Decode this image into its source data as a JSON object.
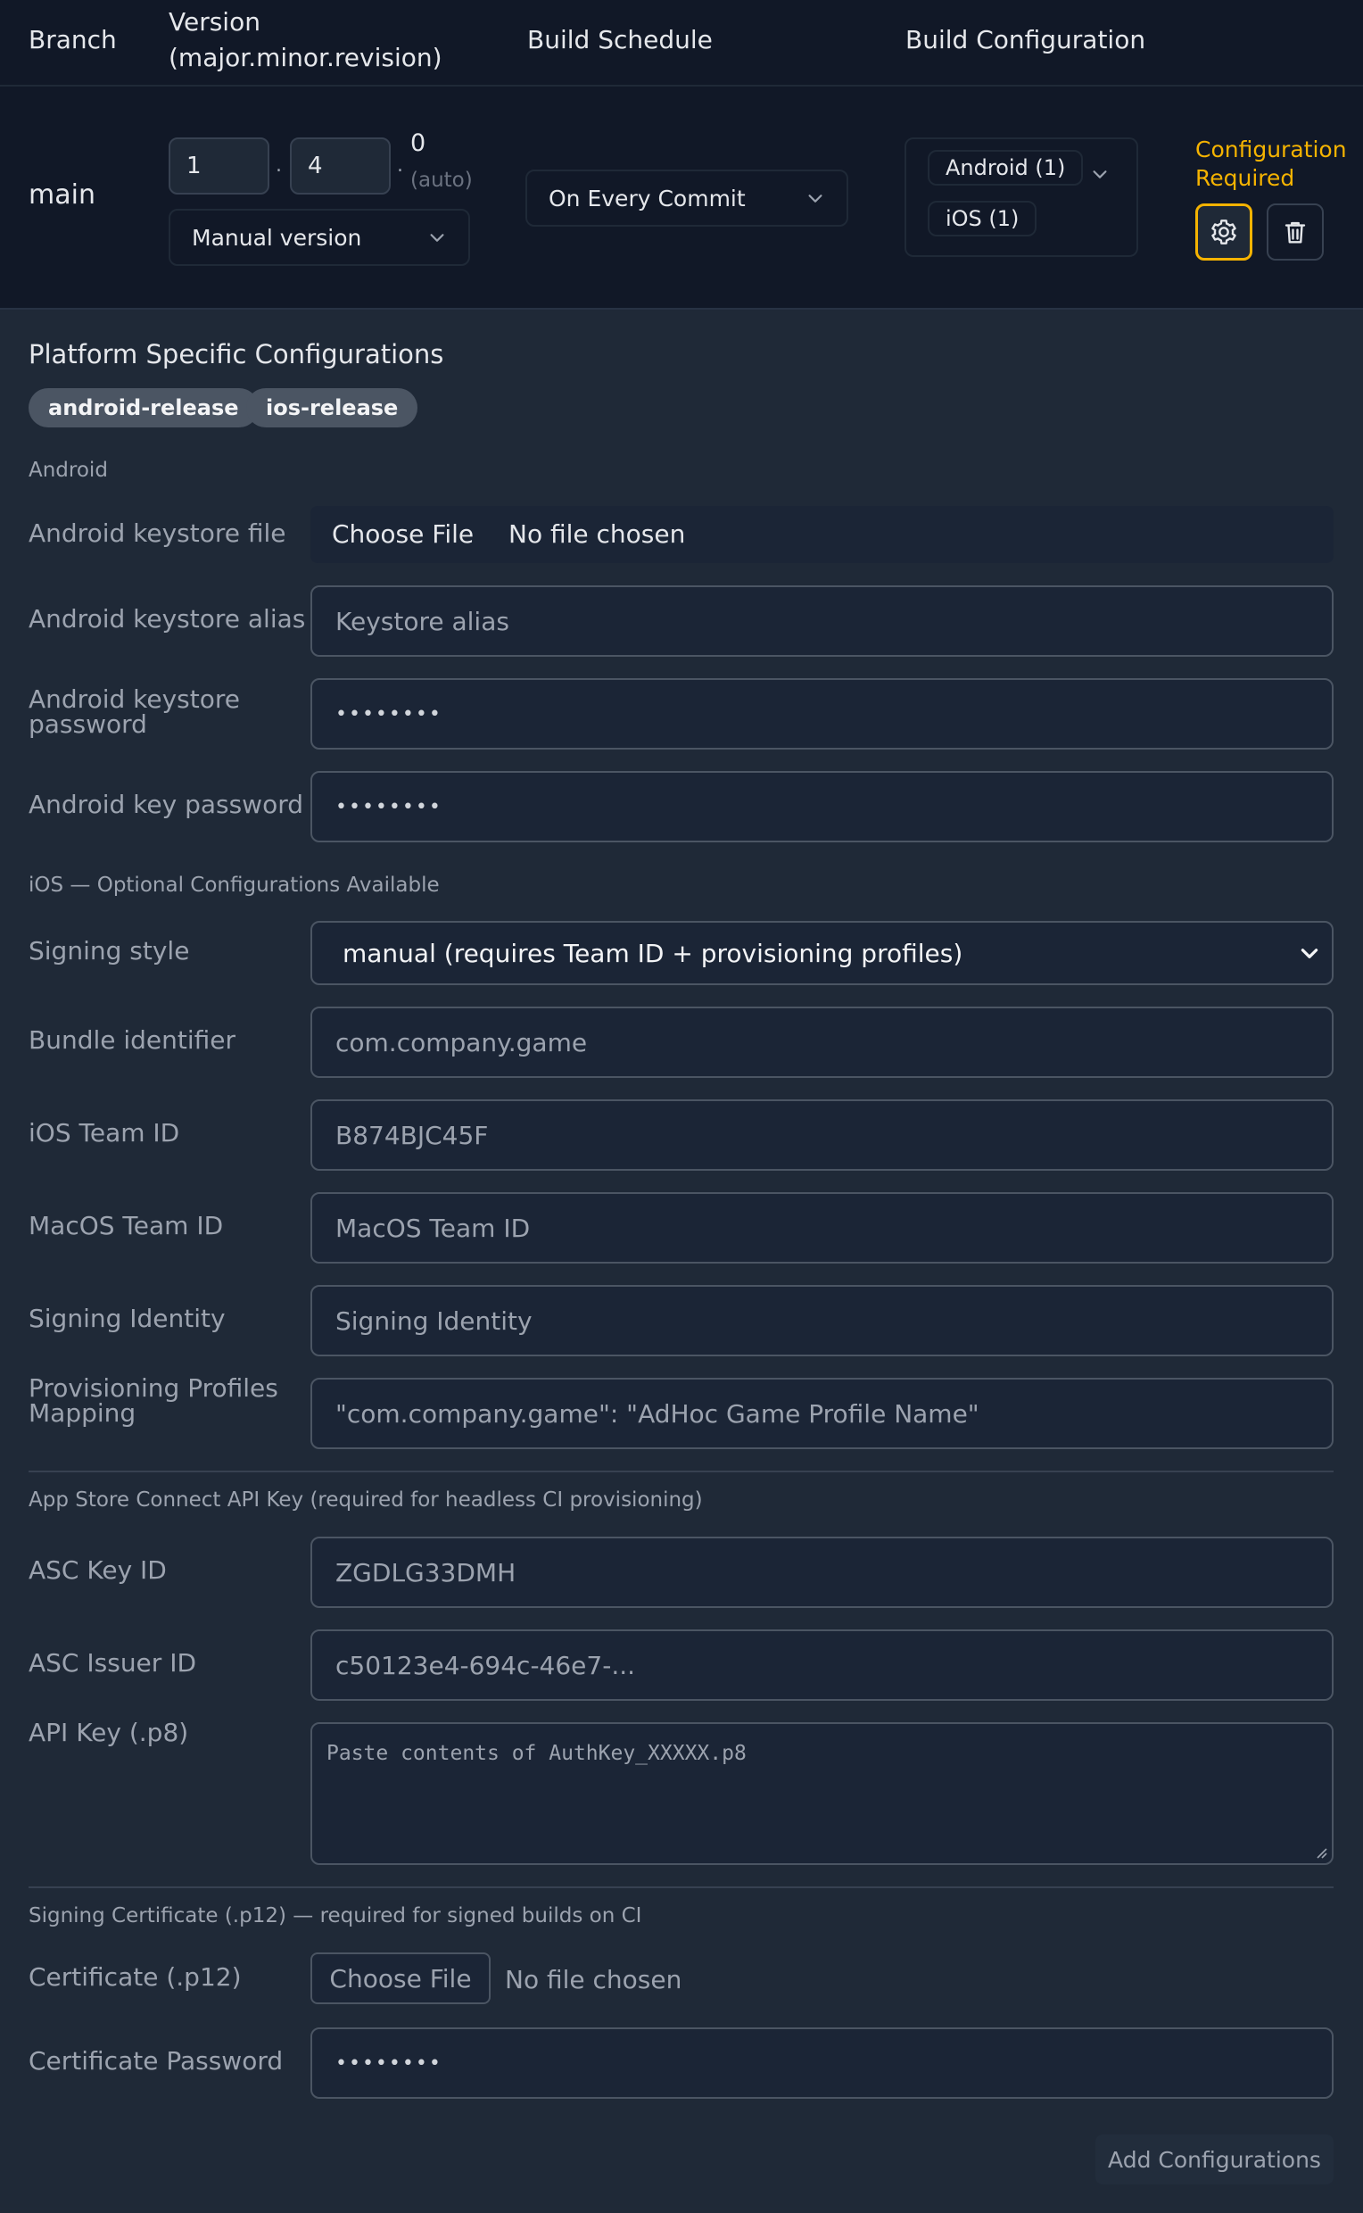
{
  "header": {
    "branch": "Branch",
    "version_line1": "Version",
    "version_line2": "(major.minor.revision)",
    "schedule": "Build Schedule",
    "configuration": "Build Configuration"
  },
  "row": {
    "branch": "main",
    "major": "1",
    "minor": "4",
    "revision": "0",
    "revision_note": "(auto)",
    "version_mode": "Manual version",
    "schedule": "On Every Commit",
    "platforms": [
      "Android (1)",
      "iOS (1)"
    ],
    "warning_line1": "Configuration",
    "warning_line2": "Required"
  },
  "panel": {
    "title": "Platform Specific Configurations",
    "tags": [
      "android-release",
      "ios-release"
    ],
    "android": {
      "heading": "Android",
      "keystore_file_label": "Android keystore file",
      "choose_file": "Choose File",
      "no_file": "No file chosen",
      "alias_label": "Android keystore alias",
      "alias_placeholder": "Keystore alias",
      "keystore_pw_label_1": "Android keystore",
      "keystore_pw_label_2": "password",
      "keystore_pw": "••••••••",
      "key_pw_label": "Android key password",
      "key_pw": "••••••••"
    },
    "ios": {
      "heading": "iOS — Optional Configurations Available",
      "signing_style_label": "Signing style",
      "signing_style": "manual (requires Team ID + provisioning profiles)",
      "bundle_label": "Bundle identifier",
      "bundle_placeholder": "com.company.game",
      "team_label": "iOS Team ID",
      "team_value": "B874BJC45F",
      "mac_team_label": "MacOS Team ID",
      "mac_team_placeholder": "MacOS Team ID",
      "identity_label": "Signing Identity",
      "identity_placeholder": "Signing Identity",
      "profiles_label_1": "Provisioning Profiles",
      "profiles_label_2": "Mapping",
      "profiles_placeholder": "\"com.company.game\": \"AdHoc Game Profile Name\""
    },
    "asc": {
      "heading": "App Store Connect API Key (required for headless CI provisioning)",
      "key_id_label": "ASC Key ID",
      "key_id": "ZGDLG33DMH",
      "issuer_label": "ASC Issuer ID",
      "issuer": "c50123e4-694c-46e7-...",
      "p8_label": "API Key (.p8)",
      "p8_placeholder": "Paste contents of AuthKey_XXXXX.p8"
    },
    "cert": {
      "heading": "Signing Certificate (.p12) — required for signed builds on CI",
      "cert_label": "Certificate (.p12)",
      "choose_file": "Choose File",
      "no_file": "No file chosen",
      "pw_label": "Certificate Password",
      "pw": "••••••••"
    },
    "add_button": "Add Configurations"
  },
  "colors": {
    "warning": "#f5b301",
    "background": "#1f2937",
    "row_background": "#111827"
  }
}
